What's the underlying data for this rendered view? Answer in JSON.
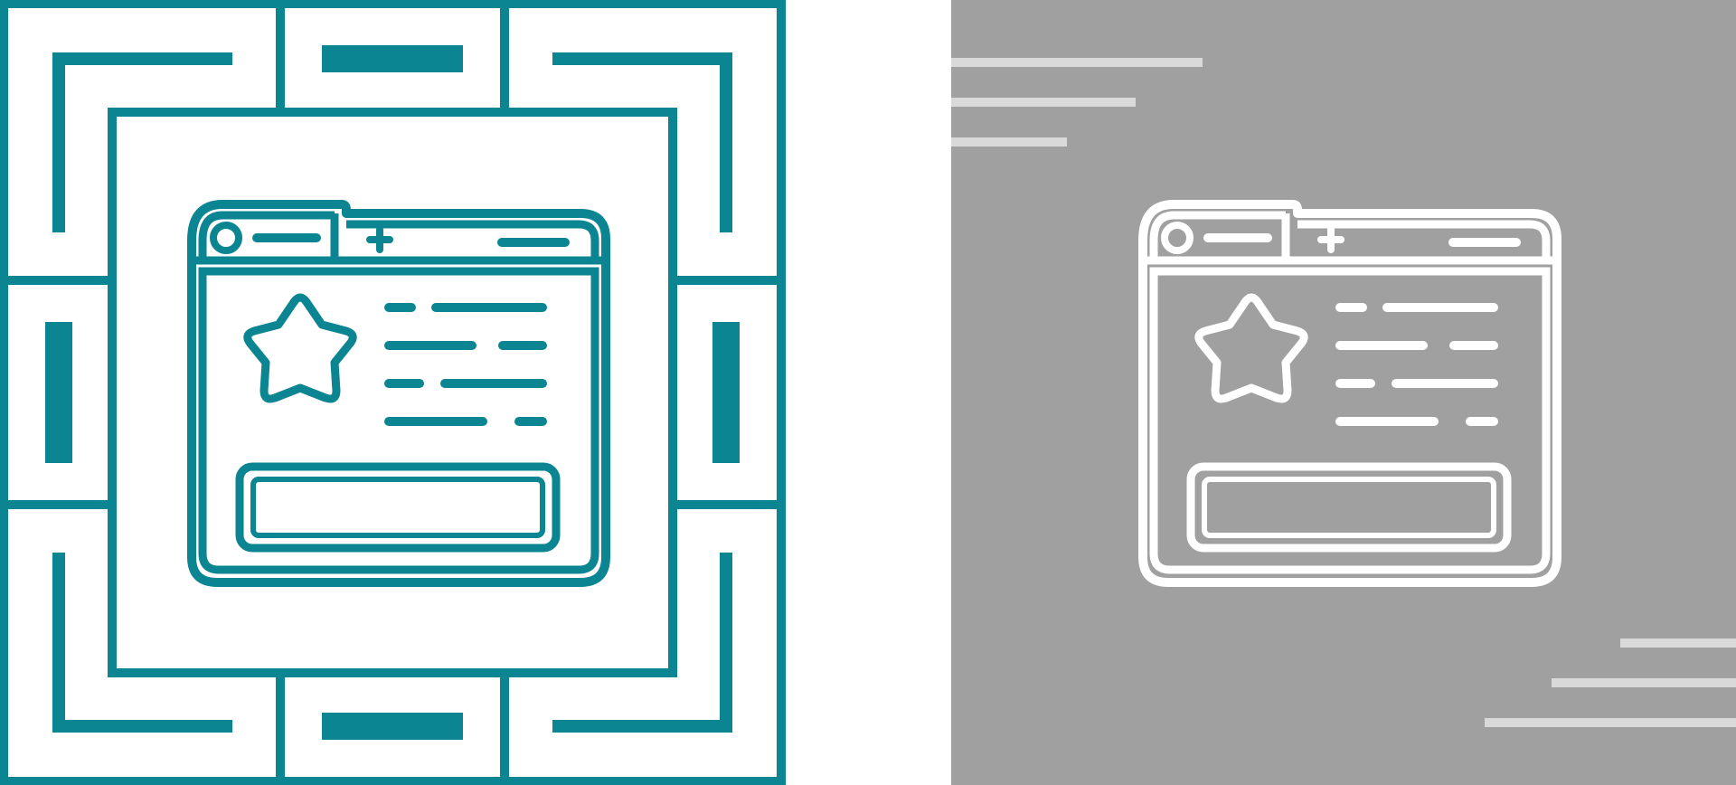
{
  "colors": {
    "background": "#ffffff",
    "accent": "#0a8591",
    "panel_gray": "#a0a0a0",
    "outline_white": "#ffffff",
    "streak": "#d9d9d9"
  },
  "icons": {
    "left": "browser-window-star-icon-teal-glyph",
    "right": "browser-window-star-icon-white-line"
  }
}
